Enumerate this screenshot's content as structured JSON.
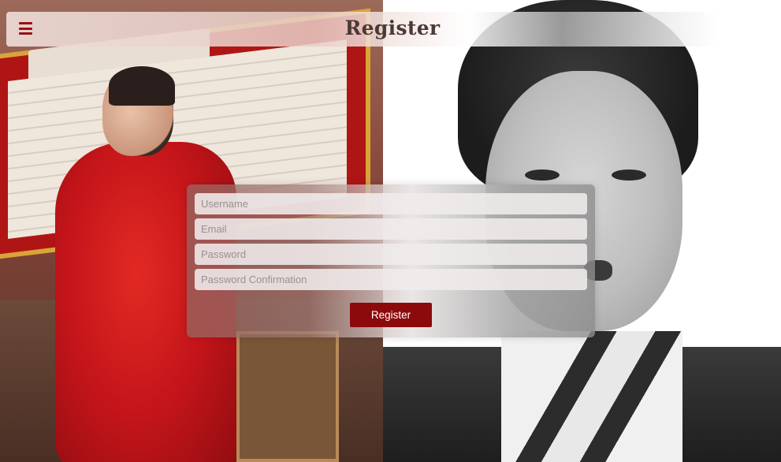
{
  "header": {
    "title": "Register",
    "menu_icon": "hamburger-menu-icon"
  },
  "form": {
    "fields": [
      {
        "name": "username",
        "placeholder": "Username",
        "value": ""
      },
      {
        "name": "email",
        "placeholder": "Email",
        "value": ""
      },
      {
        "name": "password",
        "placeholder": "Password",
        "value": ""
      },
      {
        "name": "password_confirmation",
        "placeholder": "Password Confirmation",
        "value": ""
      }
    ],
    "submit_label": "Register"
  },
  "colors": {
    "accent": "#8c0a0c",
    "menu_icon": "#9b0f15",
    "title_text": "#4a3a36"
  }
}
